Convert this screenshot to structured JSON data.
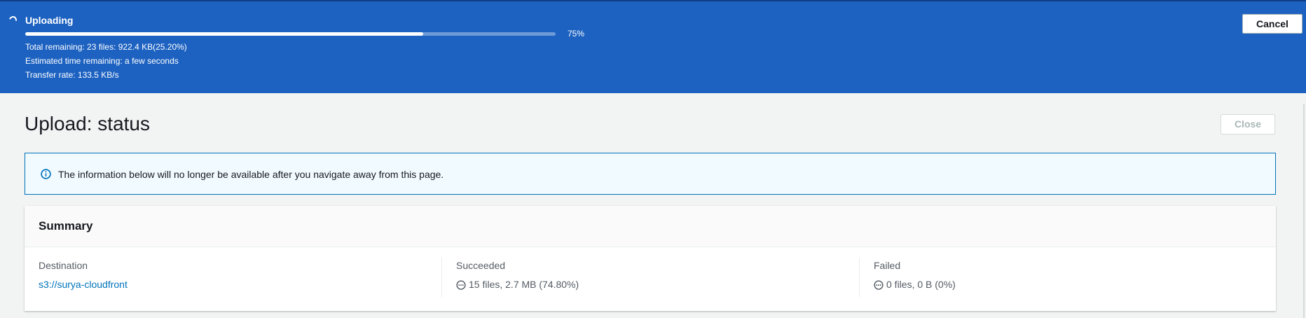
{
  "banner": {
    "title": "Uploading",
    "progress_percent": 75,
    "progress_label": "75%",
    "total_remaining": "Total remaining: 23 files: 922.4 KB(25.20%)",
    "estimated_time": "Estimated time remaining: a few seconds",
    "transfer_rate": "Transfer rate: 133.5 KB/s",
    "cancel_label": "Cancel",
    "color": "#1d62c1"
  },
  "page": {
    "title": "Upload: status",
    "close_label": "Close"
  },
  "alert": {
    "icon": "info-icon",
    "text": "The information below will no longer be available after you navigate away from this page."
  },
  "summary": {
    "title": "Summary",
    "destination": {
      "label": "Destination",
      "value": "s3://surya-cloudfront"
    },
    "succeeded": {
      "label": "Succeeded",
      "icon": "pending-icon",
      "value": "15 files, 2.7 MB (74.80%)"
    },
    "failed": {
      "label": "Failed",
      "icon": "pending-icon",
      "value": "0 files, 0 B (0%)"
    }
  },
  "colors": {
    "link": "#0073bb",
    "info_border": "#0073bb",
    "info_bg": "#f1faff"
  }
}
